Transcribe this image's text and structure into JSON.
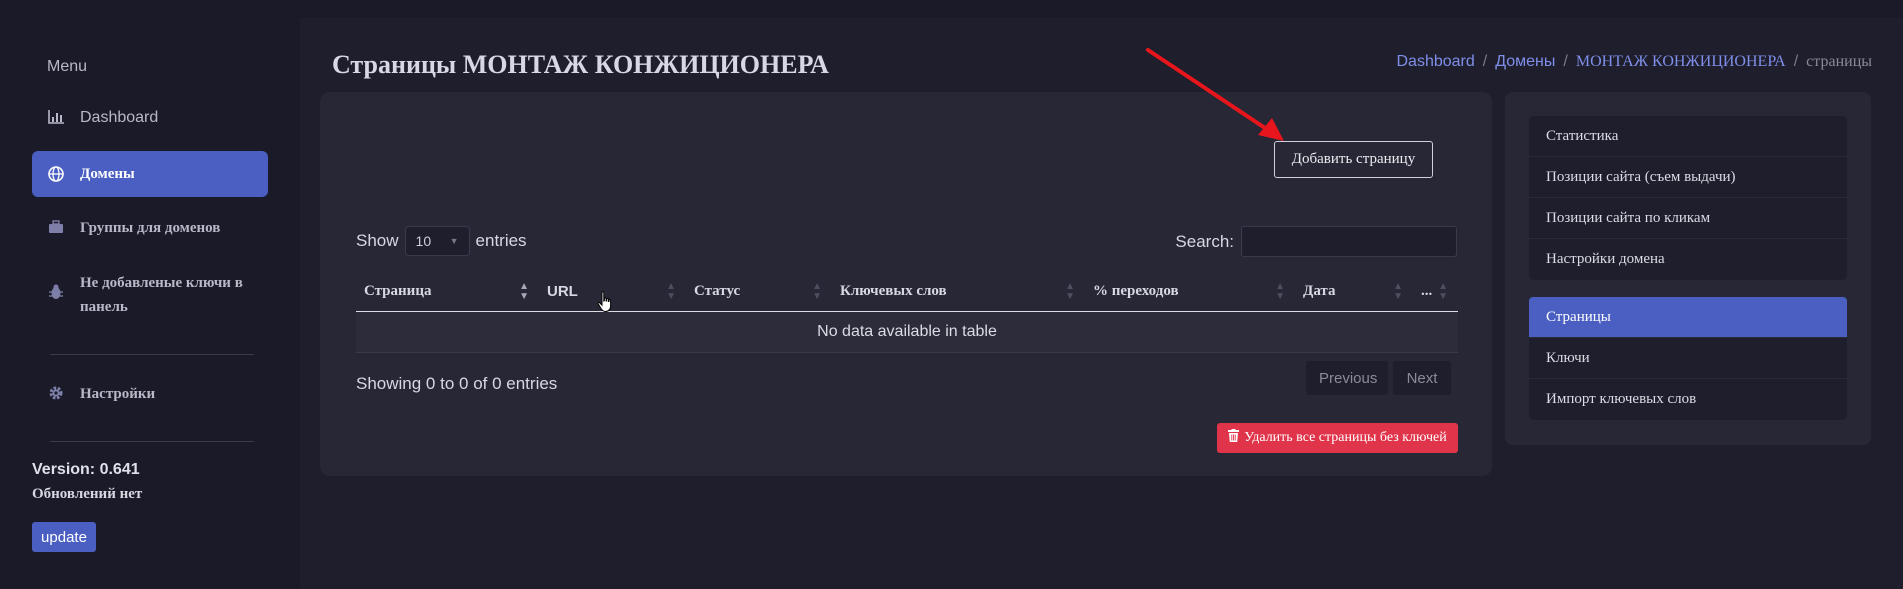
{
  "sidebar": {
    "menu_title": "Menu",
    "items": [
      {
        "label": "Dashboard",
        "icon": "chart-icon"
      },
      {
        "label": "Домены",
        "icon": "globe-icon",
        "active": true
      },
      {
        "label": "Группы для доменов",
        "icon": "briefcase-icon"
      },
      {
        "label": "Не добавленые ключи в панель",
        "icon": "bug-icon"
      },
      {
        "label": "Настройки",
        "icon": "gear-icon"
      }
    ],
    "version": "Version: 0.641",
    "updates": "Обновлений нет",
    "update_button": "update"
  },
  "header": {
    "title": "Страницы МОНТАЖ КОНЖИЦИОНЕРА",
    "breadcrumb": [
      {
        "label": "Dashboard"
      },
      {
        "label": "Домены"
      },
      {
        "label": "МОНТАЖ КОНЖИЦИОНЕРА"
      },
      {
        "label": "страницы"
      }
    ],
    "separator": "/"
  },
  "main": {
    "add_button": "Добавить страницу",
    "show_label": "Show",
    "entries_value": "10",
    "entries_label": "entries",
    "search_label": "Search:",
    "search_value": "",
    "columns": [
      "Страница",
      "URL",
      "Статус",
      "Ключевых слов",
      "% переходов",
      "Дата",
      "..."
    ],
    "empty_message": "No data available in table",
    "info": "Showing 0 to 0 of 0 entries",
    "pagination": {
      "previous": "Previous",
      "next": "Next"
    },
    "delete_button": "Удалить все страницы без ключей"
  },
  "right_panel": {
    "group1": [
      "Статистика",
      "Позиции сайта (съем выдачи)",
      "Позиции сайта по кликам",
      "Настройки домена"
    ],
    "group2": [
      "Страницы",
      "Ключи",
      "Импорт ключевых слов"
    ],
    "active": "Страницы"
  },
  "colors": {
    "background": "#1e1e2d",
    "sidebar": "#1a1a28",
    "card": "#272736",
    "accent": "#4a5fc1",
    "danger": "#e0344a",
    "link": "#7f8ee8",
    "annotation_arrow": "#e8161c"
  }
}
